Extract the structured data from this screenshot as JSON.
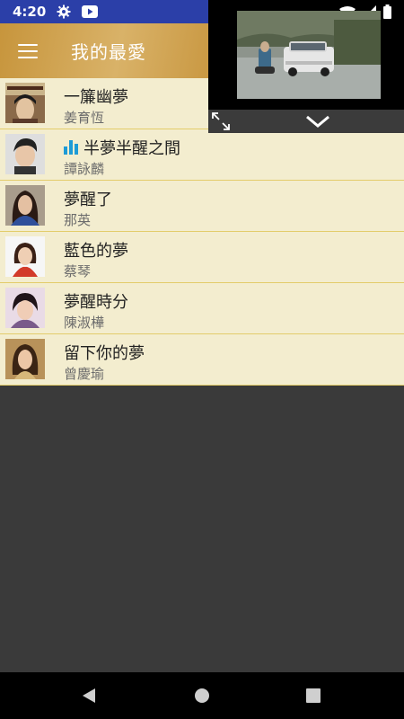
{
  "status_bar": {
    "time": "4:20",
    "icons": [
      "gear-icon",
      "youtube-icon",
      "wifi-icon",
      "signal-icon",
      "battery-icon"
    ]
  },
  "app_bar": {
    "title": "我的最愛",
    "menu_icon": "hamburger-menu-icon"
  },
  "songs": [
    {
      "title": "一簾幽夢",
      "artist": "姜育恆",
      "playing": false
    },
    {
      "title": "半夢半醒之間",
      "artist": "譚詠麟",
      "playing": true
    },
    {
      "title": "夢醒了",
      "artist": "那英",
      "playing": false
    },
    {
      "title": "藍色的夢",
      "artist": "蔡琴",
      "playing": false
    },
    {
      "title": "夢醒時分",
      "artist": "陳淑樺",
      "playing": false
    },
    {
      "title": "留下你的夢",
      "artist": "曾慶瑜",
      "playing": false
    }
  ],
  "video_player": {
    "expand_icon": "expand-icon",
    "collapse_icon": "chevron-down-icon"
  },
  "nav_bar": {
    "icons": [
      "back-icon",
      "home-icon",
      "recents-icon"
    ]
  },
  "colors": {
    "status_bar": "#2b3fa8",
    "list_bg": "#f3edcf",
    "divider": "#e3cc6a",
    "playing_icon": "#1d9bd6",
    "empty_bg": "#3a3a3a"
  }
}
